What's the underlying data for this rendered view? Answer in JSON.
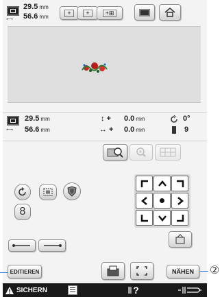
{
  "header": {
    "width_value": "29.5",
    "height_value": "56.6",
    "unit": "mm"
  },
  "status": {
    "width_value": "29.5",
    "height_value": "56.6",
    "unit": "mm",
    "vertical_offset": "0.0",
    "horizontal_offset": "0.0",
    "vertical_symbol": "↕ +",
    "horizontal_symbol": "↔ +",
    "angle": "0°",
    "color_count": "9"
  },
  "controls": {
    "density_label": "8"
  },
  "actions": {
    "edit_label": "EDITIEREN",
    "sew_label": "NÄHEN"
  },
  "footer": {
    "save_label": "SICHERN",
    "help_label": "?"
  },
  "callout": {
    "number": "②"
  },
  "colors": {
    "accent_red": "#cc2222",
    "footer_bg": "#1a1a1a",
    "callout_line": "#3a7bd5"
  }
}
